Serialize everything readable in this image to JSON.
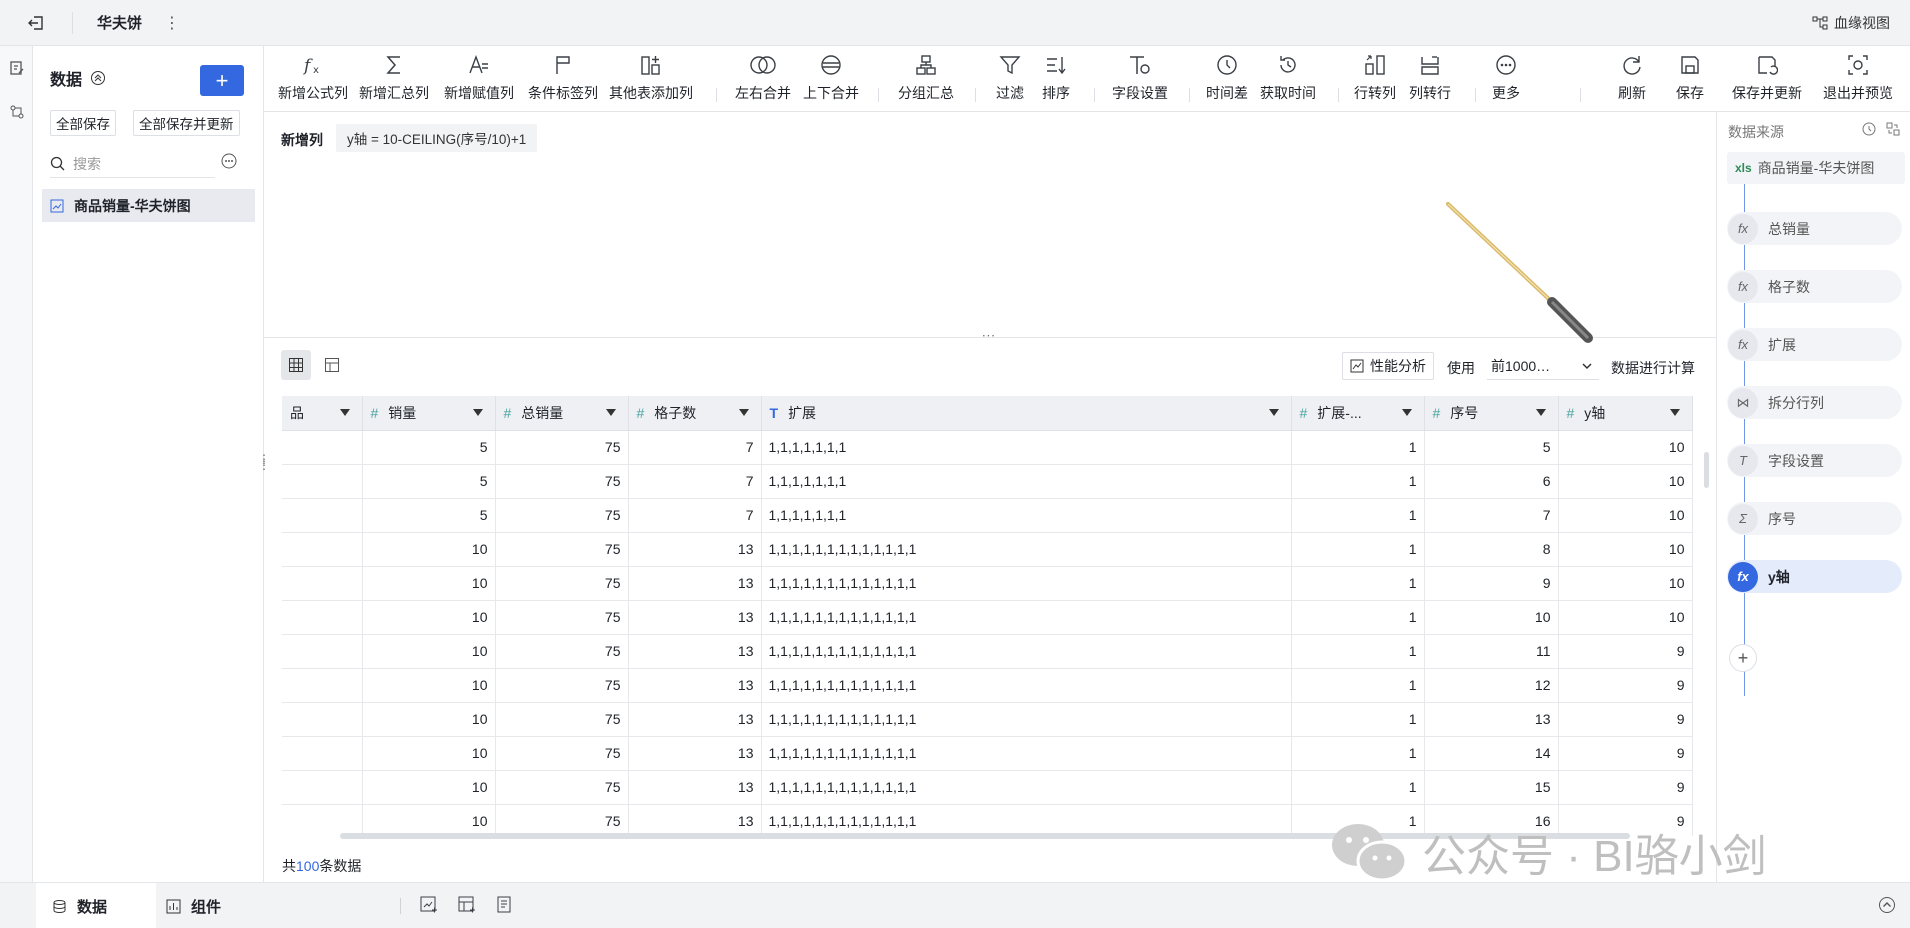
{
  "topbar": {
    "title": "华夫饼",
    "more": "⋮",
    "lineage_label": "血缘视图"
  },
  "left_panel": {
    "heading": "数据",
    "add_label": "+",
    "save_all": "全部保存",
    "save_all_update": "全部保存并更新",
    "search_placeholder": "搜索",
    "dataset": "商品销量-华夫饼图"
  },
  "toolbar": {
    "items": [
      {
        "label": "新增公式列",
        "icon": "formula-icon"
      },
      {
        "label": "新增汇总列",
        "icon": "sigma-icon"
      },
      {
        "label": "新增赋值列",
        "icon": "assign-icon"
      },
      {
        "label": "条件标签列",
        "icon": "flag-icon"
      },
      {
        "label": "其他表添加列",
        "icon": "add-column-icon"
      },
      {
        "label": "左右合并",
        "icon": "merge-lr-icon"
      },
      {
        "label": "上下合并",
        "icon": "merge-tb-icon"
      },
      {
        "label": "分组汇总",
        "icon": "group-icon"
      },
      {
        "label": "过滤",
        "icon": "filter-icon"
      },
      {
        "label": "排序",
        "icon": "sort-icon"
      },
      {
        "label": "字段设置",
        "icon": "field-settings-icon"
      },
      {
        "label": "时间差",
        "icon": "clock-icon"
      },
      {
        "label": "获取时间",
        "icon": "get-time-icon"
      },
      {
        "label": "行转列",
        "icon": "row-to-col-icon"
      },
      {
        "label": "列转行",
        "icon": "col-to-row-icon"
      },
      {
        "label": "更多",
        "icon": "more-icon"
      },
      {
        "label": "刷新",
        "icon": "refresh-icon"
      },
      {
        "label": "保存",
        "icon": "save-icon"
      },
      {
        "label": "保存并更新",
        "icon": "save-update-icon"
      },
      {
        "label": "退出并预览",
        "icon": "exit-preview-icon"
      }
    ]
  },
  "editor": {
    "label": "新增列",
    "formula": "y轴 = 10-CEILING(序号/10)+1",
    "grip": ":::"
  },
  "grid_controls": {
    "perf_label": "性能分析",
    "use_label": "使用",
    "row_select": "前1000…",
    "calc_label": "数据进行计算"
  },
  "table": {
    "columns": [
      {
        "name": "品",
        "type": "",
        "align": "left"
      },
      {
        "name": "销量",
        "type": "#",
        "align": "right"
      },
      {
        "name": "总销量",
        "type": "#",
        "align": "right"
      },
      {
        "name": "格子数",
        "type": "#",
        "align": "right"
      },
      {
        "name": "扩展",
        "type": "T",
        "align": "left"
      },
      {
        "name": "扩展-...",
        "type": "#",
        "align": "right"
      },
      {
        "name": "序号",
        "type": "#",
        "align": "right"
      },
      {
        "name": "y轴",
        "type": "#",
        "align": "right"
      }
    ],
    "rows": [
      [
        "",
        "5",
        "75",
        "7",
        "1,1,1,1,1,1,1",
        "1",
        "5",
        "10"
      ],
      [
        "",
        "5",
        "75",
        "7",
        "1,1,1,1,1,1,1",
        "1",
        "6",
        "10"
      ],
      [
        "",
        "5",
        "75",
        "7",
        "1,1,1,1,1,1,1",
        "1",
        "7",
        "10"
      ],
      [
        "",
        "10",
        "75",
        "13",
        "1,1,1,1,1,1,1,1,1,1,1,1,1",
        "1",
        "8",
        "10"
      ],
      [
        "",
        "10",
        "75",
        "13",
        "1,1,1,1,1,1,1,1,1,1,1,1,1",
        "1",
        "9",
        "10"
      ],
      [
        "",
        "10",
        "75",
        "13",
        "1,1,1,1,1,1,1,1,1,1,1,1,1",
        "1",
        "10",
        "10"
      ],
      [
        "",
        "10",
        "75",
        "13",
        "1,1,1,1,1,1,1,1,1,1,1,1,1",
        "1",
        "11",
        "9"
      ],
      [
        "",
        "10",
        "75",
        "13",
        "1,1,1,1,1,1,1,1,1,1,1,1,1",
        "1",
        "12",
        "9"
      ],
      [
        "",
        "10",
        "75",
        "13",
        "1,1,1,1,1,1,1,1,1,1,1,1,1",
        "1",
        "13",
        "9"
      ],
      [
        "",
        "10",
        "75",
        "13",
        "1,1,1,1,1,1,1,1,1,1,1,1,1",
        "1",
        "14",
        "9"
      ],
      [
        "",
        "10",
        "75",
        "13",
        "1,1,1,1,1,1,1,1,1,1,1,1,1",
        "1",
        "15",
        "9"
      ],
      [
        "",
        "10",
        "75",
        "13",
        "1,1,1,1,1,1,1,1,1,1,1,1,1",
        "1",
        "16",
        "9"
      ]
    ],
    "count_prefix": "共",
    "count_value": "100",
    "count_suffix": "条数据"
  },
  "right_panel": {
    "title": "数据来源",
    "source": {
      "badge": "xls",
      "label": "商品销量-华夫饼图"
    },
    "steps": [
      {
        "label": "总销量",
        "icon": "fx"
      },
      {
        "label": "格子数",
        "icon": "fx"
      },
      {
        "label": "扩展",
        "icon": "fx"
      },
      {
        "label": "拆分行列",
        "icon": "⋈"
      },
      {
        "label": "字段设置",
        "icon": "T"
      },
      {
        "label": "序号",
        "icon": "Σ"
      },
      {
        "label": "y轴",
        "icon": "fx"
      }
    ],
    "add": "+"
  },
  "bottombar": {
    "tab_data": "数据",
    "tab_component": "组件"
  },
  "watermark": {
    "text": "公众号 · BI骆小剑"
  },
  "colors": {
    "accent": "#3468e0",
    "header_bg": "#eef0f4",
    "bar_bg": "#f2f3f5"
  }
}
